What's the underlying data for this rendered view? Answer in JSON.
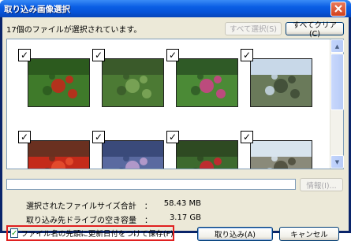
{
  "window": {
    "title": "取り込み画像選択",
    "close_label": "×"
  },
  "toolbar": {
    "count_text": "17個のファイルが選択されています。",
    "select_all_label": "すべて選択(S)",
    "clear_all_label": "すべてクリア(C)"
  },
  "thumbnails": [
    {
      "checked": true,
      "check_glyph": "✓",
      "subject": "red berries with green leaves",
      "colors": {
        "sky": "#2c5a1e",
        "main": "#3f7a2a",
        "accent": "#c8261a"
      }
    },
    {
      "checked": true,
      "check_glyph": "✓",
      "subject": "green shrub",
      "colors": {
        "sky": "#3a5a2a",
        "main": "#4c7a34",
        "accent": "#7fa85a"
      }
    },
    {
      "checked": true,
      "check_glyph": "✓",
      "subject": "pink flower with leaves",
      "colors": {
        "sky": "#2f5a26",
        "main": "#4b8a36",
        "accent": "#d0408a"
      }
    },
    {
      "checked": true,
      "check_glyph": "✓",
      "subject": "tree against sky",
      "colors": {
        "sky": "#c8d8e8",
        "main": "#6a7a5a",
        "accent": "#3d4a35"
      }
    },
    {
      "checked": true,
      "check_glyph": "✓",
      "subject": "red flowers",
      "colors": {
        "sky": "#6a3020",
        "main": "#c42a1a",
        "accent": "#e85030"
      }
    },
    {
      "checked": true,
      "check_glyph": "✓",
      "subject": "purple flower bed",
      "colors": {
        "sky": "#3a4a7a",
        "main": "#5a6aa0",
        "accent": "#c0a0d0"
      }
    },
    {
      "checked": true,
      "check_glyph": "✓",
      "subject": "red rose",
      "colors": {
        "sky": "#2e4a22",
        "main": "#3d6a2e",
        "accent": "#d42030"
      }
    },
    {
      "checked": true,
      "check_glyph": "✓",
      "subject": "bare tree and sky",
      "colors": {
        "sky": "#d8e4ee",
        "main": "#8a8a7a",
        "accent": "#4a4a3a"
      }
    }
  ],
  "scroll": {
    "up_glyph": "▲",
    "down_glyph": "▼"
  },
  "info_button_label": "情報(I)...",
  "summary": {
    "total_label": "選択されたファイルサイズ合計　：",
    "total_value": "58.43 MB",
    "free_label": "取り込み先ドライブの空き容量　：",
    "free_value": "3.17 GB"
  },
  "options": {
    "save_with_date_label": "ファイル名の先頭に更新日付をつけて保存(F)",
    "save_with_date_checked": true,
    "check_glyph": "✓"
  },
  "actions": {
    "import_label": "取り込み(A)",
    "cancel_label": "キャンセル"
  }
}
